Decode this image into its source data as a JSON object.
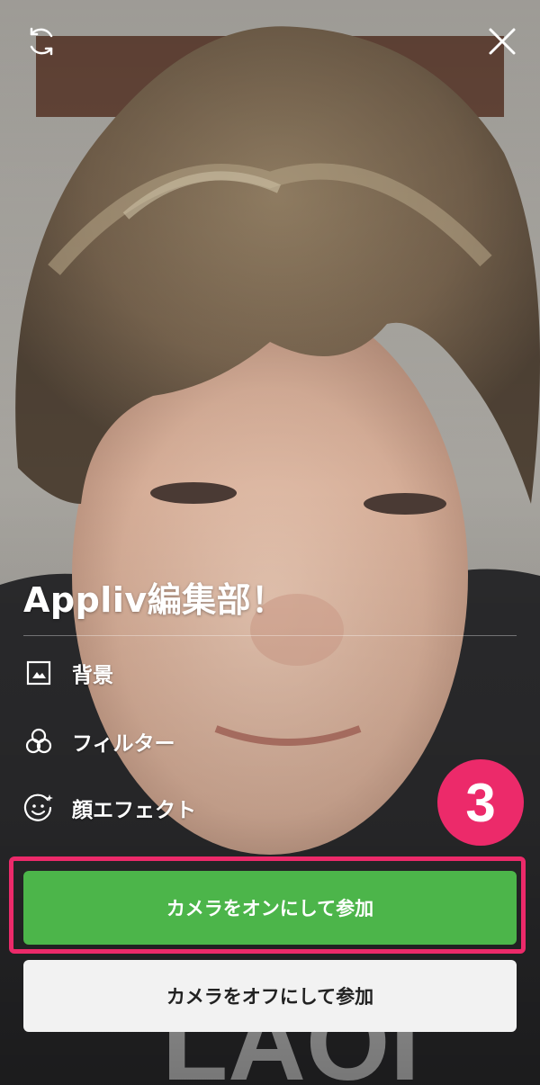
{
  "top_bar": {
    "switch_camera_icon": "refresh-arrows",
    "close_icon": "x"
  },
  "group": {
    "name": "Appliv編集部！"
  },
  "menu": {
    "items": [
      {
        "label": "背景",
        "icon": "image-frame"
      },
      {
        "label": "フィルター",
        "icon": "three-circles"
      },
      {
        "label": "顔エフェクト",
        "icon": "smiley-sparkle"
      }
    ]
  },
  "annotation": {
    "step_number": "3",
    "highlight_color": "#ec2a6a"
  },
  "actions": {
    "join_camera_on": "カメラをオンにして参加",
    "join_camera_off": "カメラをオフにして参加"
  },
  "colors": {
    "primary_green": "#4cb54a",
    "secondary_button": "#f2f2f2",
    "accent_pink": "#ec2a6a"
  }
}
